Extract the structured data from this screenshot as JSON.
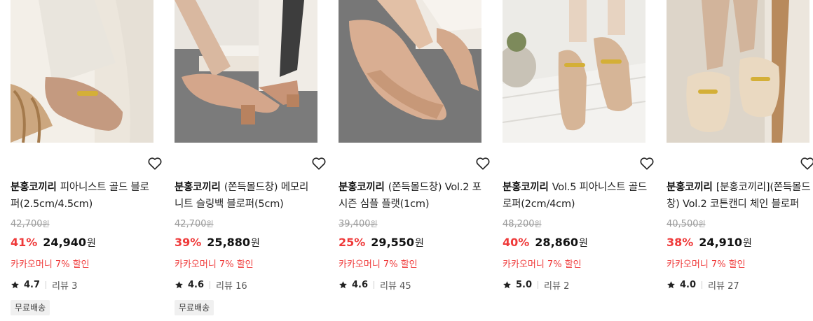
{
  "products": [
    {
      "brand": "분홍코끼리",
      "name": "피아니스트 골드 블로퍼(2.5cm/4.5cm)",
      "original_price": "42,700",
      "won": "원",
      "discount": "41%",
      "price": "24,940",
      "kakao": "카카오머니 7% 할인",
      "rating": "4.7",
      "reviews": "리뷰 3",
      "badge": "무료배송"
    },
    {
      "brand": "분홍코끼리",
      "name": "(쫀득몰드창) 메모리 니트 슬링백 블로퍼(5cm)",
      "original_price": "42,700",
      "won": "원",
      "discount": "39%",
      "price": "25,880",
      "kakao": "카카오머니 7% 할인",
      "rating": "4.6",
      "reviews": "리뷰 16",
      "badge": "무료배송"
    },
    {
      "brand": "분홍코끼리",
      "name": "(쫀득몰드창) Vol.2 포시즌 심플 플랫(1cm)",
      "original_price": "39,400",
      "won": "원",
      "discount": "25%",
      "price": "29,550",
      "kakao": "카카오머니 7% 할인",
      "rating": "4.6",
      "reviews": "리뷰 45"
    },
    {
      "brand": "분홍코끼리",
      "name": "Vol.5 피아니스트 골드 로퍼(2cm/4cm)",
      "original_price": "48,200",
      "won": "원",
      "discount": "40%",
      "price": "28,860",
      "kakao": "카카오머니 7% 할인",
      "rating": "5.0",
      "reviews": "리뷰 2"
    },
    {
      "brand": "분홍코끼리",
      "name": "[분홍코끼리](쫀득몰드창) Vol.2 코튼캔디 체인 블로퍼",
      "original_price": "40,500",
      "won": "원",
      "discount": "38%",
      "price": "24,910",
      "kakao": "카카오머니 7% 할인",
      "rating": "4.0",
      "reviews": "리뷰 27"
    }
  ],
  "icons": {
    "wishlist": "heart-outline-icon",
    "rating": "star-icon"
  },
  "colors": {
    "discount": "#ef3a3a",
    "kakao": "#ef3a3a",
    "badge_bg": "#f0f0f0"
  }
}
